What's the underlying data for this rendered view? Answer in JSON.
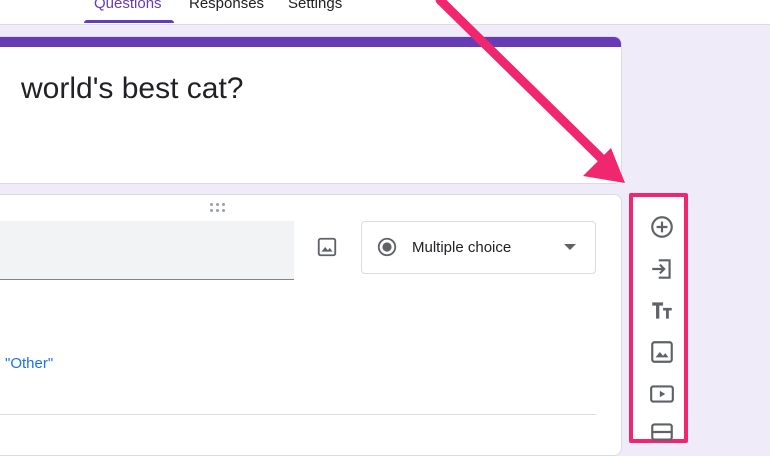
{
  "tabs": [
    {
      "label": "Questions",
      "active": true
    },
    {
      "label": "Responses",
      "active": false
    },
    {
      "label": "Settings",
      "active": false
    }
  ],
  "form": {
    "title": "world's best cat?"
  },
  "question": {
    "type_label": "Multiple choice",
    "other_option": "\"Other\""
  },
  "toolbar": {
    "items": [
      "add-question-icon",
      "import-questions-icon",
      "add-title-icon",
      "add-image-icon",
      "add-video-icon",
      "add-section-icon"
    ]
  },
  "colors": {
    "accent": "#673ab7",
    "highlight": "#f0266f",
    "link": "#1a73e8",
    "background": "#f0ebf8"
  }
}
